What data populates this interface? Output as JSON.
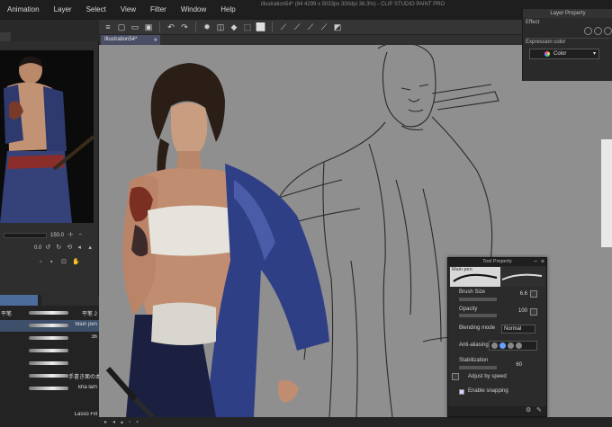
{
  "menu": {
    "items": [
      "Animation",
      "Layer",
      "Select",
      "View",
      "Filter",
      "Window",
      "Help"
    ],
    "window_title": "illustration54* (84 4299 x 5033px 300dpi 36.3%) - CLIP STUDIO PAINT PRO"
  },
  "document_tab": {
    "label": "Illustration54*"
  },
  "navigator": {
    "zoom_value": "150.0",
    "angle_value": "0.0"
  },
  "brushes": {
    "rows": [
      {
        "left": "平笔",
        "right": "平笔 2"
      },
      {
        "left": "",
        "right": "Main pen"
      },
      {
        "left": "",
        "right": "36"
      },
      {
        "left": "",
        "right": ""
      },
      {
        "left": "",
        "right": ""
      },
      {
        "left": "",
        "right": "手書き面の本線"
      },
      {
        "left": "",
        "right": "kha lam"
      },
      {
        "left": "",
        "right": "Lasso Fill"
      }
    ]
  },
  "layer_property": {
    "title": "Layer Property",
    "effect_label": "Effect",
    "expression_color_label": "Expression color",
    "expression_color_value": "Color"
  },
  "tool_property": {
    "title": "Tool Property",
    "brush_name": "Main pen",
    "brush_size_label": "Brush Size",
    "brush_size_value": "6.6",
    "opacity_label": "Opacity",
    "opacity_value": "100",
    "blending_mode_label": "Blending mode",
    "blending_mode_value": "Normal",
    "anti_aliasing_label": "Anti-aliasing",
    "stabilization_label": "Stabilization",
    "stabilization_value": "60",
    "adjust_by_speed_label": "Adjust by speed",
    "enable_snapping_label": "Enable snapping",
    "enable_snapping_checked": true
  }
}
